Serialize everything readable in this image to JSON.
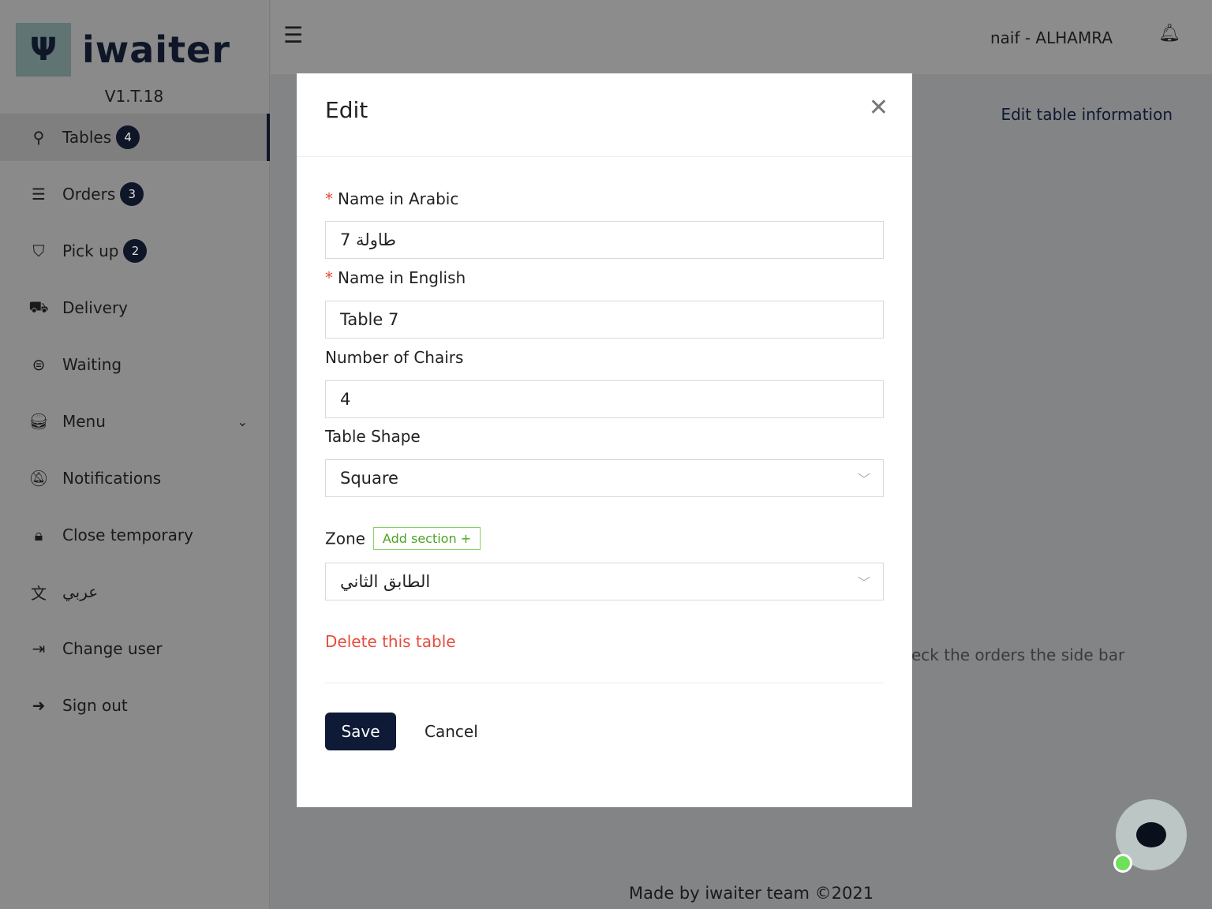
{
  "app": {
    "logo_text": "iwaiter",
    "version": "V1.T.18"
  },
  "sidebar": {
    "items": [
      {
        "label": "Tables",
        "badge": "4",
        "icon": "table-icon",
        "active": true
      },
      {
        "label": "Orders",
        "badge": "3",
        "icon": "list-icon"
      },
      {
        "label": "Pick up",
        "badge": "2",
        "icon": "bag-icon"
      },
      {
        "label": "Delivery",
        "icon": "car-icon"
      },
      {
        "label": "Waiting",
        "icon": "waiting-list-icon"
      },
      {
        "label": "Menu",
        "icon": "food-icon",
        "has_dropdown": true
      },
      {
        "label": "Notifications",
        "icon": "bell-off-icon"
      },
      {
        "label": "Close temporary",
        "icon": "lock-icon"
      },
      {
        "label": "عربي",
        "icon": "translate-icon"
      },
      {
        "label": "Change user",
        "icon": "logout-icon"
      },
      {
        "label": "Sign out",
        "icon": "sign-out-icon"
      }
    ]
  },
  "header": {
    "user": "naif - ALHAMRA"
  },
  "page": {
    "edit_info": "Edit table information",
    "hint": "eck the orders the side bar",
    "footer": "Made by iwaiter team ©2021"
  },
  "modal": {
    "title": "Edit",
    "name_ar_label": "Name in Arabic",
    "name_ar_value": "طاولة 7",
    "name_en_label": "Name in English",
    "name_en_value": "Table 7",
    "chairs_label": "Number of Chairs",
    "chairs_value": "4",
    "shape_label": "Table Shape",
    "shape_value": "Square",
    "zone_label": "Zone",
    "add_section": "Add section +",
    "zone_value": "الطابق الثاني",
    "delete": "Delete this table",
    "save": "Save",
    "cancel": "Cancel"
  },
  "colors": {
    "primary": "#0e1a36",
    "danger": "#e74c3c",
    "success": "#4ea326"
  }
}
